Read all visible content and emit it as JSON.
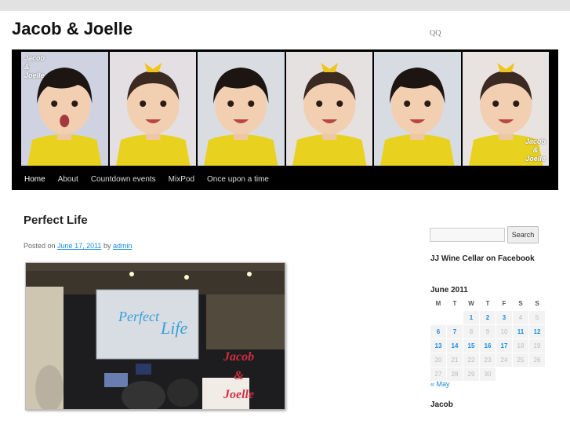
{
  "site": {
    "title": "Jacob & Joelle",
    "description": "QQ"
  },
  "banner": {
    "watermark_top": "Jacob\n&\nJoelle",
    "watermark_bottom": "Jacob\n&\nJoelle"
  },
  "nav": {
    "items": [
      "Home",
      "About",
      "Countdown events",
      "MixPod",
      "Once upon a time"
    ],
    "active": "Home"
  },
  "post": {
    "title": "Perfect Life",
    "posted_on_label": "Posted on",
    "date": "June 17, 2011",
    "by_label": "by",
    "author": "admin",
    "image": {
      "sign_word1": "Perfect",
      "sign_word2": "Life",
      "watermark": "Jacob\n&\nJoelle"
    }
  },
  "sidebar": {
    "search_placeholder": "",
    "search_button": "Search",
    "facebook_widget": "JJ Wine Cellar on Facebook",
    "calendar": {
      "caption": "June 2011",
      "headers": [
        "M",
        "T",
        "W",
        "T",
        "F",
        "S",
        "S"
      ],
      "weeks": [
        [
          "",
          "",
          "1",
          "2",
          "3",
          "4",
          "5"
        ],
        [
          "6",
          "7",
          "8",
          "9",
          "10",
          "11",
          "12"
        ],
        [
          "13",
          "14",
          "15",
          "16",
          "17",
          "18",
          "19"
        ],
        [
          "20",
          "21",
          "22",
          "23",
          "24",
          "25",
          "26"
        ],
        [
          "27",
          "28",
          "29",
          "30",
          "",
          "",
          ""
        ]
      ],
      "linked_days": [
        "1",
        "2",
        "3",
        "6",
        "7",
        "11",
        "12",
        "13",
        "14",
        "15",
        "16",
        "17"
      ],
      "prev_link": "« May"
    },
    "jacob_widget": "Jacob"
  },
  "colors": {
    "link": "#1b8be0",
    "nav_bg": "#000000",
    "shirt": "#e8d21f"
  }
}
